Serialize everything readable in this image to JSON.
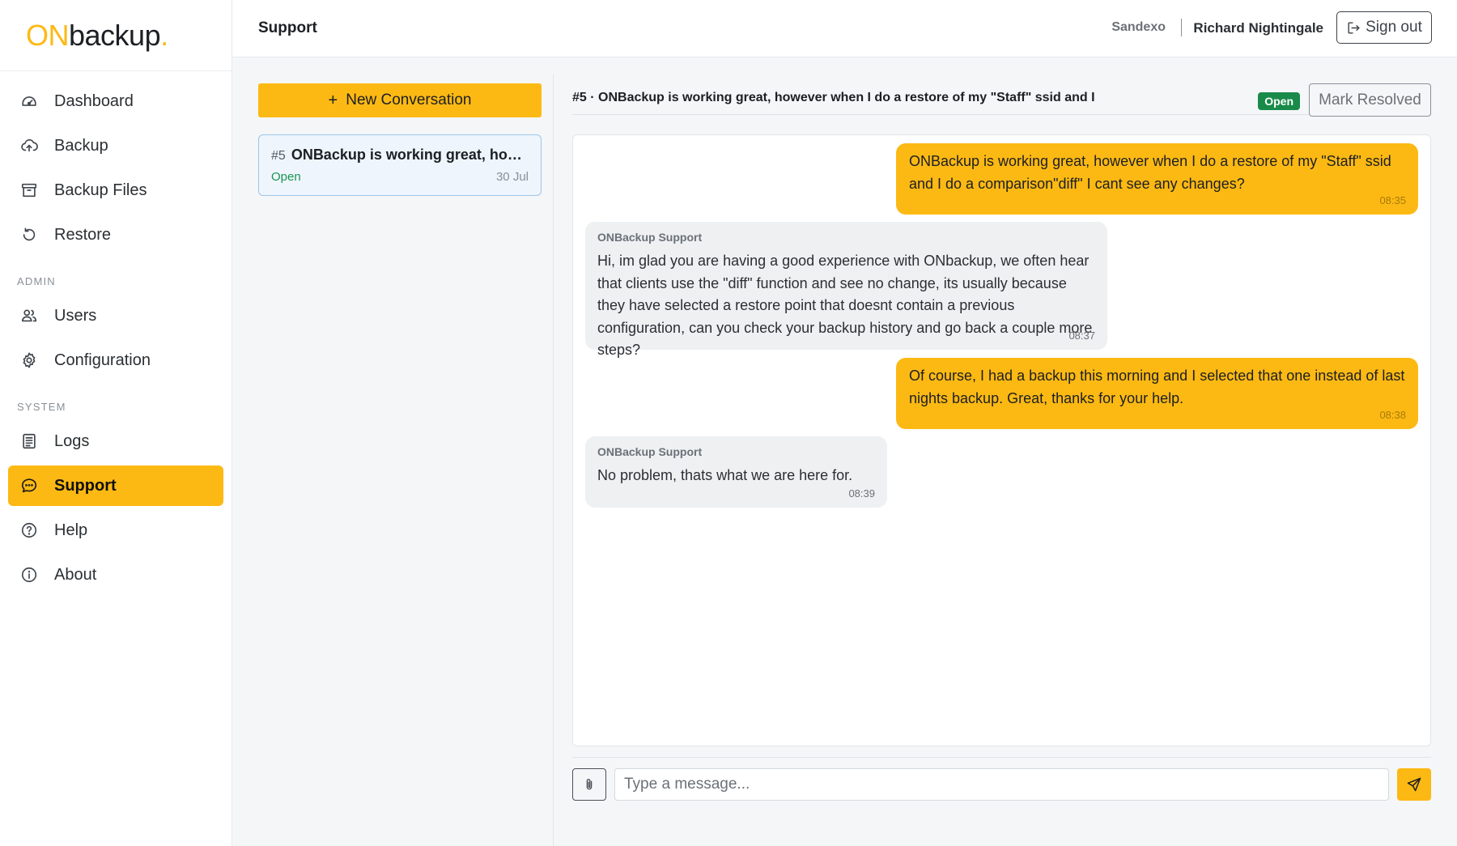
{
  "logo": {
    "part1": "ON",
    "part2": "backup",
    "part3": "."
  },
  "sidebar": {
    "items": [
      {
        "label": "Dashboard",
        "icon": "gauge-icon"
      },
      {
        "label": "Backup",
        "icon": "cloud-upload-icon"
      },
      {
        "label": "Backup Files",
        "icon": "archive-icon"
      },
      {
        "label": "Restore",
        "icon": "rotate-ccw-icon"
      }
    ],
    "admin_label": "ADMIN",
    "admin_items": [
      {
        "label": "Users",
        "icon": "users-icon"
      },
      {
        "label": "Configuration",
        "icon": "gear-icon"
      }
    ],
    "system_label": "SYSTEM",
    "system_items": [
      {
        "label": "Logs",
        "icon": "log-icon"
      },
      {
        "label": "Support",
        "icon": "chat-icon",
        "active": true
      },
      {
        "label": "Help",
        "icon": "help-icon"
      },
      {
        "label": "About",
        "icon": "info-icon"
      }
    ]
  },
  "header": {
    "title": "Support",
    "org": "Sandexo",
    "user": "Richard Nightingale",
    "signout_label": "Sign out"
  },
  "conversations": {
    "new_label": "New Conversation",
    "items": [
      {
        "num": "#5",
        "title": "ONBackup is working great, how...",
        "status": "Open",
        "date": "30 Jul"
      }
    ]
  },
  "thread": {
    "title": "#5 · ONBackup is working great, however when I do a restore of my \"Staff\" ssid and I",
    "status": "Open",
    "mark_resolved_label": "Mark Resolved",
    "messages": [
      {
        "direction": "out",
        "text": "ONBackup is working great, however when I do a restore of my \"Staff\" ssid and I do a comparison\"diff\" I cant see any changes?",
        "time": "08:35"
      },
      {
        "direction": "in",
        "sender": "ONBackup Support",
        "text": "Hi, im glad you are having a good experience with ONbackup, we often hear that clients use the \"diff\" function and see no change, its usually because they have selected a restore point that doesnt contain a previous configuration, can you check your backup history and go back a couple more steps?",
        "time": "08:37"
      },
      {
        "direction": "out",
        "text": "Of course, I had a backup this morning and I selected that one instead of last nights backup. Great, thanks for your help.",
        "time": "08:38"
      },
      {
        "direction": "in",
        "sender": "ONBackup Support",
        "text": "No problem, thats what we are here for.",
        "time": "08:39"
      }
    ]
  },
  "composer": {
    "placeholder": "Type a message...",
    "value": ""
  },
  "colors": {
    "accent": "#fdb913",
    "open_badge": "#1a8a4a",
    "open_text": "#1a9455"
  }
}
